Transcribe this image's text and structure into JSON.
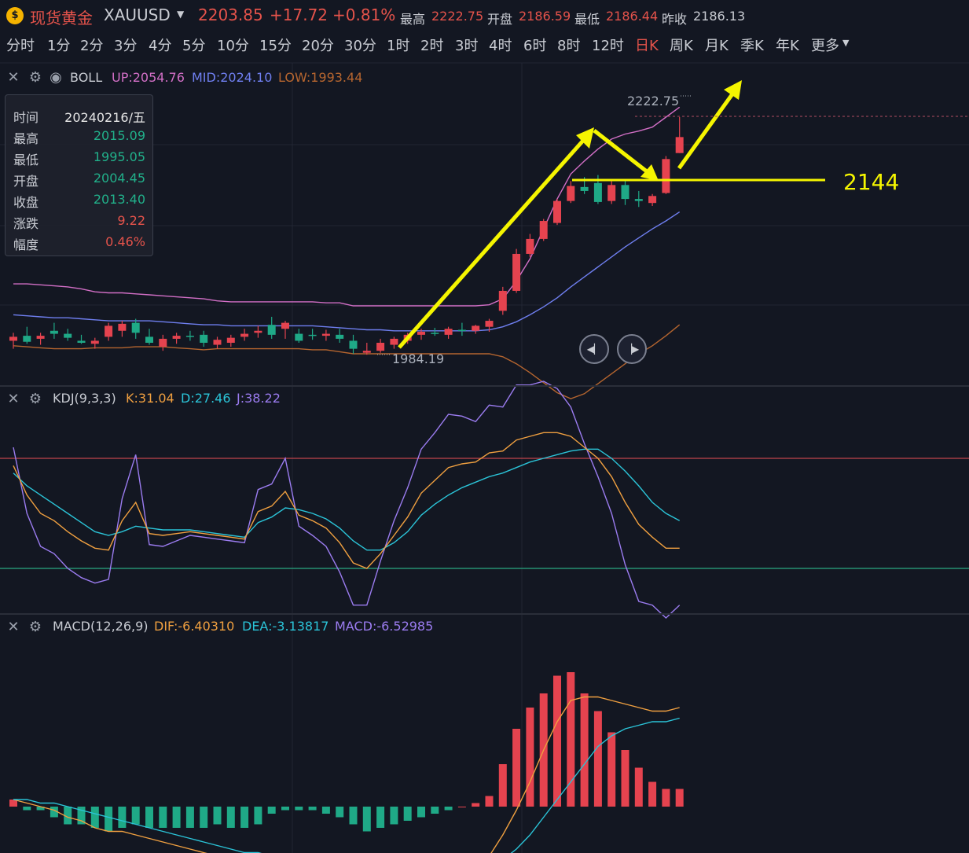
{
  "header": {
    "logo_glyph": "$",
    "title": "现货黄金",
    "symbol": "XAUUSD",
    "price": "2203.85",
    "change": "+17.72",
    "change_pct": "+0.81%",
    "high_label": "最高",
    "high": "2222.75",
    "open_label": "开盘",
    "open": "2186.59",
    "low_label": "最低",
    "low": "2186.44",
    "prev_close_label": "昨收",
    "prev_close": "2186.13"
  },
  "tabs": [
    {
      "label": "分时"
    },
    {
      "label": "1分"
    },
    {
      "label": "2分"
    },
    {
      "label": "3分"
    },
    {
      "label": "4分"
    },
    {
      "label": "5分"
    },
    {
      "label": "10分"
    },
    {
      "label": "15分"
    },
    {
      "label": "20分"
    },
    {
      "label": "30分"
    },
    {
      "label": "1时"
    },
    {
      "label": "2时"
    },
    {
      "label": "3时"
    },
    {
      "label": "4时"
    },
    {
      "label": "6时"
    },
    {
      "label": "8时"
    },
    {
      "label": "12时"
    },
    {
      "label": "日K",
      "active": true
    },
    {
      "label": "周K"
    },
    {
      "label": "月K"
    },
    {
      "label": "季K"
    },
    {
      "label": "年K"
    },
    {
      "label": "更多"
    }
  ],
  "boll_panel": {
    "name": "BOLL",
    "up_label": "UP:2054.76",
    "mid_label": "MID:2024.10",
    "low_label": "LOW:1993.44",
    "colors": {
      "up": "#d26fc6",
      "mid": "#6f7ff0",
      "low": "#b5652f"
    },
    "high_marker": "2222.75",
    "low_marker": "1984.19",
    "annotation_level": "2144"
  },
  "tooltip": {
    "rows": [
      {
        "key": "时间",
        "value": "20240216/五",
        "color": "#e6e6e6"
      },
      {
        "key": "最高",
        "value": "2015.09",
        "color": "#21b08a"
      },
      {
        "key": "最低",
        "value": "1995.05",
        "color": "#21b08a"
      },
      {
        "key": "开盘",
        "value": "2004.45",
        "color": "#21b08a"
      },
      {
        "key": "收盘",
        "value": "2013.40",
        "color": "#21b08a"
      },
      {
        "key": "涨跌",
        "value": "9.22",
        "color": "#e5534b"
      },
      {
        "key": "幅度",
        "value": "0.46%",
        "color": "#e5534b"
      }
    ]
  },
  "kdj_panel": {
    "name": "KDJ(9,3,3)",
    "k_label": "K:31.04",
    "d_label": "D:27.46",
    "j_label": "J:38.22",
    "colors": {
      "k": "#f0a040",
      "d": "#2bc4d8",
      "j": "#9b7cf0"
    }
  },
  "macd_panel": {
    "name": "MACD(12,26,9)",
    "dif_label": "DIF:-6.40310",
    "dea_label": "DEA:-3.13817",
    "macd_label": "MACD:-6.52985",
    "colors": {
      "dif": "#f0a040",
      "dea": "#2bc4d8",
      "macd": "#9b7cf0"
    }
  },
  "colors": {
    "up": "#e5434f",
    "down": "#1fa987",
    "accent": "#f5f500",
    "bg": "#131722"
  },
  "chart_data": {
    "type": "candlestick",
    "ohlc": [
      [
        1998,
        2006,
        1990,
        2002
      ],
      [
        2003,
        2012,
        1995,
        1997
      ],
      [
        2000,
        2006,
        1994,
        2003
      ],
      [
        2008,
        2016,
        2000,
        2005
      ],
      [
        2005,
        2010,
        1998,
        2001
      ],
      [
        1998,
        2004,
        1995,
        1996
      ],
      [
        1995,
        2001,
        1990,
        1998
      ],
      [
        2002,
        2016,
        1998,
        2013
      ],
      [
        2008,
        2018,
        2002,
        2015
      ],
      [
        2016,
        2020,
        2000,
        2006
      ],
      [
        2002,
        2010,
        1994,
        1996
      ],
      [
        1992,
        2004,
        1988,
        2000
      ],
      [
        2000,
        2006,
        1995,
        2003
      ],
      [
        2003,
        2008,
        1998,
        2002
      ],
      [
        2004,
        2008,
        1992,
        1996
      ],
      [
        1994,
        2002,
        1990,
        1999
      ],
      [
        1996,
        2004,
        1992,
        2001
      ],
      [
        2002,
        2010,
        1998,
        2005
      ],
      [
        2006,
        2013,
        2001,
        2008
      ],
      [
        2014,
        2022,
        2000,
        2004
      ],
      [
        2010,
        2018,
        2000,
        2016
      ],
      [
        2005,
        2010,
        1996,
        1998
      ],
      [
        2004,
        2010,
        1999,
        2003
      ],
      [
        2003,
        2009,
        1998,
        2005
      ],
      [
        2004,
        2010,
        1996,
        2000
      ],
      [
        1998,
        2004,
        1985,
        1990
      ],
      [
        1986,
        1996,
        1984,
        1988
      ],
      [
        1988,
        2000,
        1986,
        1996
      ],
      [
        1994,
        2002,
        1990,
        2000
      ],
      [
        1998,
        2006,
        1995,
        2004
      ],
      [
        2004,
        2010,
        1999,
        2007
      ],
      [
        2006,
        2011,
        2003,
        2005
      ],
      [
        2004,
        2012,
        2000,
        2010
      ],
      [
        2009,
        2016,
        2003,
        2008
      ],
      [
        2008,
        2014,
        2005,
        2013
      ],
      [
        2012,
        2020,
        2007,
        2018
      ],
      [
        2028,
        2052,
        2024,
        2048
      ],
      [
        2048,
        2090,
        2046,
        2085
      ],
      [
        2085,
        2105,
        2082,
        2100
      ],
      [
        2100,
        2120,
        2098,
        2118
      ],
      [
        2116,
        2140,
        2114,
        2138
      ],
      [
        2138,
        2158,
        2136,
        2153
      ],
      [
        2152,
        2162,
        2145,
        2148
      ],
      [
        2156,
        2164,
        2135,
        2137
      ],
      [
        2138,
        2158,
        2135,
        2154
      ],
      [
        2154,
        2158,
        2134,
        2140
      ],
      [
        2140,
        2148,
        2132,
        2138
      ],
      [
        2136,
        2145,
        2133,
        2143
      ],
      [
        2146,
        2183,
        2145,
        2180
      ],
      [
        2186,
        2222,
        2186,
        2202
      ]
    ],
    "boll_up": [
      2055,
      2055,
      2054,
      2053,
      2052,
      2050,
      2047,
      2046,
      2046,
      2045,
      2044,
      2043,
      2042,
      2041,
      2040,
      2038,
      2037,
      2037,
      2037,
      2037,
      2037,
      2037,
      2037,
      2036,
      2036,
      2033,
      2033,
      2033,
      2033,
      2033,
      2033,
      2033,
      2033,
      2033,
      2033,
      2034,
      2040,
      2058,
      2080,
      2110,
      2140,
      2165,
      2178,
      2190,
      2200,
      2205,
      2208,
      2212,
      2222,
      2232
    ],
    "boll_mid": [
      2024,
      2023,
      2022,
      2021,
      2021,
      2020,
      2019,
      2018,
      2018,
      2018,
      2018,
      2017,
      2016,
      2015,
      2014,
      2014,
      2013,
      2013,
      2013,
      2013,
      2013,
      2013,
      2013,
      2012,
      2011,
      2010,
      2009,
      2009,
      2008,
      2008,
      2008,
      2008,
      2008,
      2008,
      2008,
      2009,
      2012,
      2017,
      2024,
      2032,
      2041,
      2052,
      2062,
      2072,
      2082,
      2092,
      2101,
      2110,
      2118,
      2127
    ],
    "boll_low": [
      1993,
      1992,
      1991,
      1990,
      1990,
      1990,
      1991,
      1991,
      1991,
      1992,
      1992,
      1992,
      1991,
      1990,
      1989,
      1990,
      1990,
      1990,
      1990,
      1990,
      1990,
      1990,
      1989,
      1989,
      1987,
      1985,
      1985,
      1985,
      1985,
      1985,
      1985,
      1985,
      1985,
      1985,
      1985,
      1985,
      1982,
      1975,
      1966,
      1956,
      1946,
      1940,
      1945,
      1955,
      1965,
      1975,
      1985,
      1993,
      2003,
      2014
    ],
    "kdj_k": [
      76,
      60,
      50,
      46,
      40,
      35,
      31,
      30,
      46,
      56,
      39,
      38,
      39,
      40,
      39,
      38,
      37,
      36,
      51,
      54,
      62,
      49,
      46,
      42,
      34,
      23,
      20,
      28,
      38,
      48,
      61,
      68,
      75,
      77,
      78,
      83,
      84,
      90,
      92,
      94,
      94,
      92,
      86,
      80,
      70,
      56,
      44,
      37,
      31,
      31
    ],
    "kdj_d": [
      72,
      65,
      60,
      55,
      50,
      45,
      40,
      38,
      40,
      43,
      42,
      41,
      41,
      41,
      40,
      39,
      38,
      37,
      45,
      48,
      53,
      52,
      50,
      47,
      42,
      35,
      30,
      30,
      34,
      40,
      49,
      55,
      60,
      64,
      67,
      70,
      72,
      75,
      78,
      80,
      82,
      84,
      85,
      85,
      80,
      73,
      65,
      56,
      50,
      46
    ],
    "kdj_j": [
      86,
      50,
      32,
      28,
      20,
      15,
      12,
      14,
      58,
      82,
      33,
      32,
      35,
      38,
      37,
      36,
      35,
      34,
      63,
      66,
      80,
      43,
      38,
      32,
      18,
      0,
      0,
      24,
      46,
      64,
      85,
      94,
      104,
      103,
      100,
      109,
      108,
      120,
      120,
      122,
      118,
      108,
      88,
      70,
      50,
      22,
      2,
      0,
      -7,
      0
    ],
    "dif": [
      2,
      1,
      0,
      -1,
      -3,
      -4,
      -6,
      -7,
      -7,
      -8,
      -9,
      -10,
      -11,
      -12,
      -13,
      -14,
      -15,
      -16,
      -16,
      -15,
      -15,
      -15,
      -15,
      -16,
      -18,
      -20,
      -21,
      -21,
      -20,
      -19,
      -18,
      -18,
      -17,
      -16,
      -15,
      -14,
      -8,
      -1,
      7,
      16,
      24,
      30,
      31,
      31,
      30,
      29,
      28,
      27,
      27,
      28
    ],
    "dea": [
      2,
      2,
      1,
      1,
      0,
      -1,
      -2,
      -3,
      -4,
      -5,
      -6,
      -7,
      -8,
      -9,
      -10,
      -11,
      -12,
      -13,
      -13,
      -14,
      -14,
      -14,
      -14,
      -14,
      -15,
      -16,
      -16,
      -17,
      -17,
      -17,
      -17,
      -17,
      -17,
      -17,
      -17,
      -17,
      -15,
      -12,
      -8,
      -3,
      2,
      7,
      12,
      17,
      20,
      22,
      23,
      24,
      24,
      25
    ],
    "macd": [
      2,
      -1,
      -1,
      -3,
      -5,
      -5,
      -6,
      -7,
      -6,
      -5,
      -6,
      -6,
      -6,
      -6,
      -6,
      -5,
      -6,
      -6,
      -5,
      -2,
      -1,
      -1,
      -1,
      -2,
      -3,
      -5,
      -7,
      -6,
      -5,
      -4,
      -3,
      -2,
      -1,
      0,
      1,
      3,
      12,
      22,
      28,
      32,
      37,
      38,
      32,
      27,
      21,
      16,
      11,
      7,
      5,
      5
    ]
  }
}
